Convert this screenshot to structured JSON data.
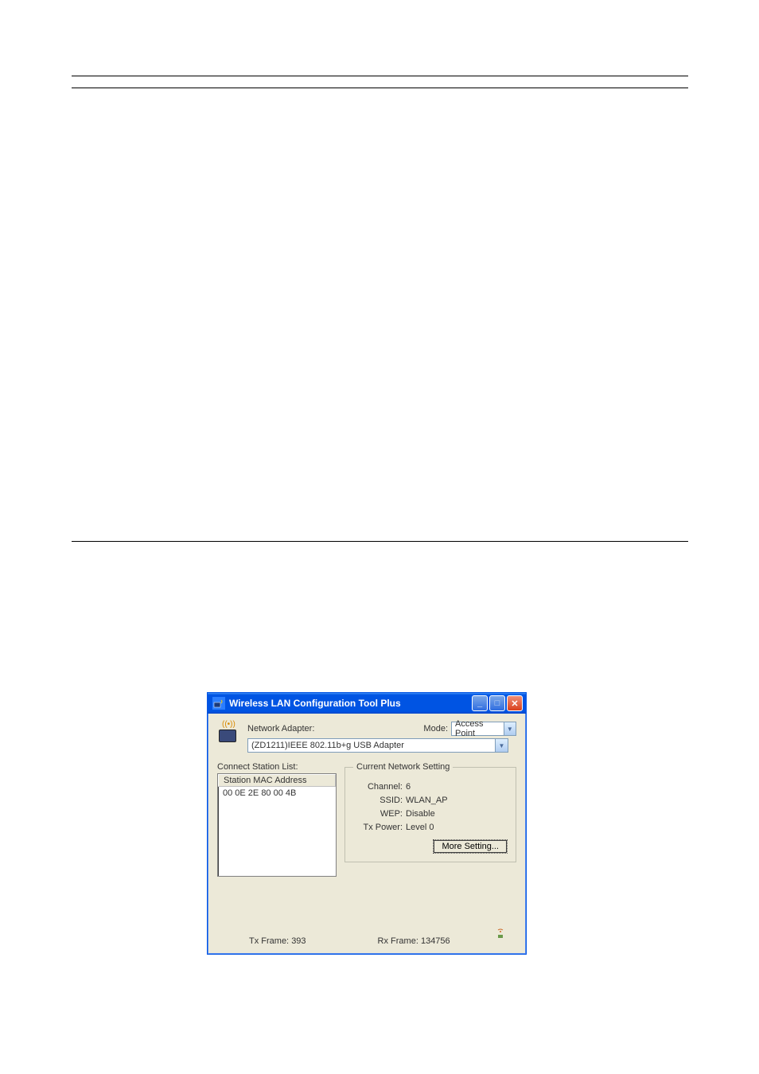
{
  "window": {
    "title": "Wireless LAN Configuration Tool Plus"
  },
  "adapter": {
    "label": "Network Adapter:",
    "value": "(ZD1211)IEEE 802.11b+g USB Adapter"
  },
  "mode": {
    "label": "Mode:",
    "value": "Access Point"
  },
  "station": {
    "title": "Connect Station List:",
    "header": "Station MAC Address",
    "items": [
      "00 0E 2E 80 00 4B"
    ]
  },
  "network_setting": {
    "legend": "Current Network Setting",
    "channel": {
      "label": "Channel:",
      "value": "6"
    },
    "ssid": {
      "label": "SSID:",
      "value": "WLAN_AP"
    },
    "wep": {
      "label": "WEP:",
      "value": "Disable"
    },
    "tx_power": {
      "label": "Tx Power:",
      "value": "Level 0"
    },
    "more_button": "More Setting..."
  },
  "footer": {
    "tx_label": "Tx Frame:",
    "tx_value": "393",
    "rx_label": "Rx Frame:",
    "rx_value": "134756"
  }
}
